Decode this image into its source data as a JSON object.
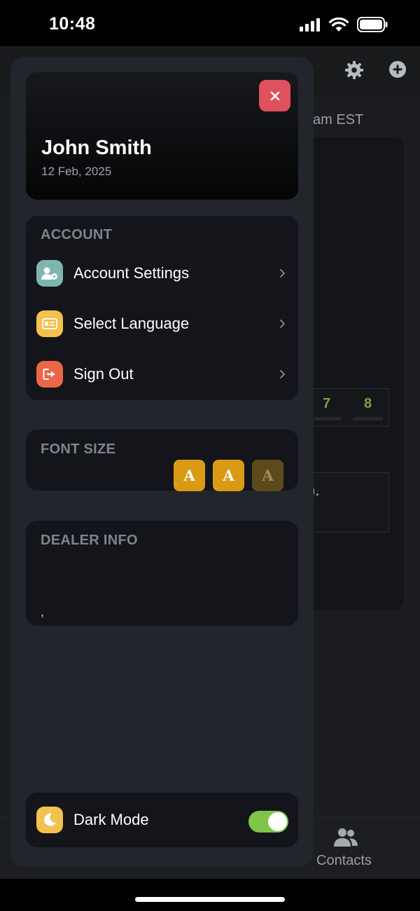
{
  "status_bar": {
    "time": "10:48"
  },
  "background": {
    "time_text": "am EST",
    "numbers": [
      "7",
      "8"
    ],
    "paren_text": ").",
    "tab_contacts_label": "Contacts"
  },
  "drawer": {
    "profile": {
      "name": "John Smith",
      "date": "12 Feb, 2025"
    },
    "account": {
      "title": "ACCOUNT",
      "items": [
        {
          "label": "Account Settings",
          "icon": "user-gear-icon",
          "color": "#7fb5b0"
        },
        {
          "label": "Select Language",
          "icon": "language-card-icon",
          "color": "#f2c14e"
        },
        {
          "label": "Sign Out",
          "icon": "sign-out-icon",
          "color": "#eb6748"
        }
      ]
    },
    "font_size": {
      "title": "FONT SIZE",
      "buttons": [
        "A",
        "A",
        "A"
      ],
      "selected_count": 2
    },
    "dealer_info": {
      "title": "DEALER INFO",
      "value": ","
    },
    "dark_mode": {
      "label": "Dark Mode",
      "enabled": true
    }
  },
  "colors": {
    "accent_gold": "#d99b16",
    "toggle_on": "#7ec54a",
    "close_red": "#e0505d"
  }
}
